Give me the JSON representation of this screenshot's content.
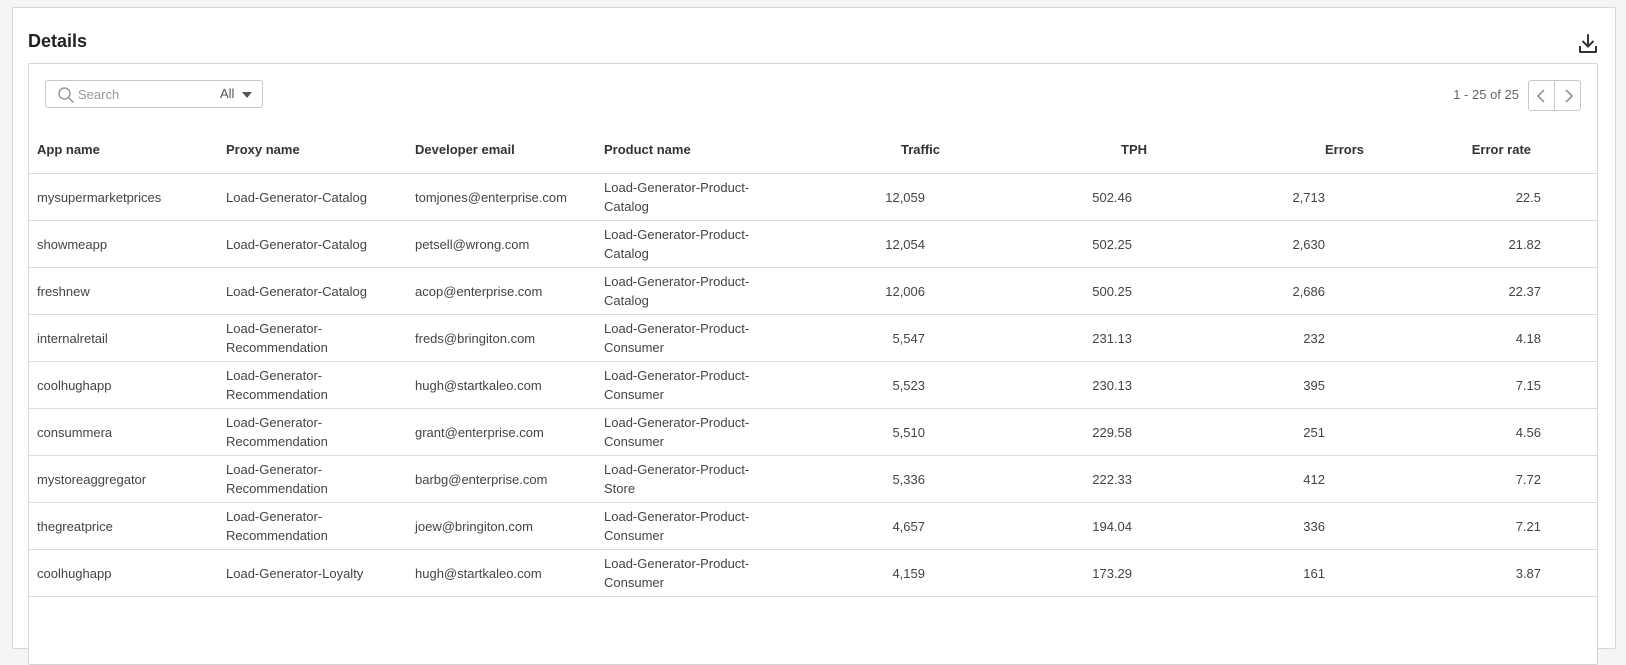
{
  "card": {
    "title": "Details",
    "download_icon": "download-icon"
  },
  "search": {
    "placeholder": "Search",
    "value": "",
    "filter": "All"
  },
  "pager": {
    "text": "1 - 25 of 25"
  },
  "columns": [
    "App name",
    "Proxy name",
    "Developer email",
    "Product name",
    "Traffic",
    "TPH",
    "Errors",
    "Error rate"
  ],
  "rows": [
    [
      "mysupermarketprices",
      "Load-Generator-Catalog",
      "tomjones@enterprise.com",
      "Load-Generator-Product-Catalog",
      "12,059",
      "502.46",
      "2,713",
      "22.5"
    ],
    [
      "showmeapp",
      "Load-Generator-Catalog",
      "petsell@wrong.com",
      "Load-Generator-Product-Catalog",
      "12,054",
      "502.25",
      "2,630",
      "21.82"
    ],
    [
      "freshnew",
      "Load-Generator-Catalog",
      "acop@enterprise.com",
      "Load-Generator-Product-Catalog",
      "12,006",
      "500.25",
      "2,686",
      "22.37"
    ],
    [
      "internalretail",
      "Load-Generator-Recommendation",
      "freds@bringiton.com",
      "Load-Generator-Product-Consumer",
      "5,547",
      "231.13",
      "232",
      "4.18"
    ],
    [
      "coolhughapp",
      "Load-Generator-Recommendation",
      "hugh@startkaleo.com",
      "Load-Generator-Product-Consumer",
      "5,523",
      "230.13",
      "395",
      "7.15"
    ],
    [
      "consummera",
      "Load-Generator-Recommendation",
      "grant@enterprise.com",
      "Load-Generator-Product-Consumer",
      "5,510",
      "229.58",
      "251",
      "4.56"
    ],
    [
      "mystoreaggregator",
      "Load-Generator-Recommendation",
      "barbg@enterprise.com",
      "Load-Generator-Product-Store",
      "5,336",
      "222.33",
      "412",
      "7.72"
    ],
    [
      "thegreatprice",
      "Load-Generator-Recommendation",
      "joew@bringiton.com",
      "Load-Generator-Product-Consumer",
      "4,657",
      "194.04",
      "336",
      "7.21"
    ],
    [
      "coolhughapp",
      "Load-Generator-Loyalty",
      "hugh@startkaleo.com",
      "Load-Generator-Product-Consumer",
      "4,159",
      "173.29",
      "161",
      "3.87"
    ]
  ]
}
